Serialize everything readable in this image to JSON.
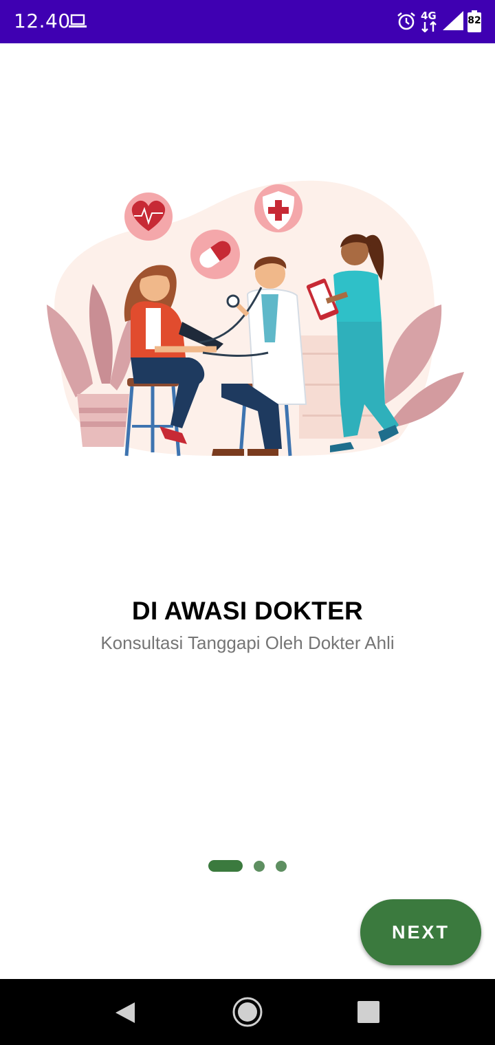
{
  "status_bar": {
    "time": "12.40",
    "network": "4G",
    "battery": "82",
    "background_color": "#3f00b2"
  },
  "onboarding": {
    "title": "DI AWASI DOKTER",
    "subtitle": "Konsultasi Tanggapi Oleh Dokter Ahli",
    "page_indicator": {
      "total": 3,
      "current": 1
    },
    "next_label": "NEXT",
    "accent_color": "#3b7a3e"
  },
  "illustration": {
    "description_icons": [
      "heart-rate-icon",
      "pill-icon",
      "medical-shield-icon"
    ]
  },
  "nav_bar": {
    "icons": [
      "back-icon",
      "home-icon",
      "recents-icon"
    ]
  }
}
